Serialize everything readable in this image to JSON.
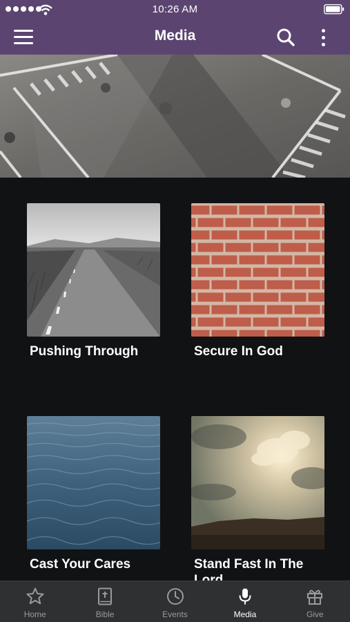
{
  "status_bar": {
    "time": "10:26 AM"
  },
  "app_bar": {
    "title": "Media"
  },
  "media": [
    {
      "title": "Pushing Through"
    },
    {
      "title": "Secure In God"
    },
    {
      "title": "Cast Your Cares"
    },
    {
      "title": "Stand Fast In The Lord"
    }
  ],
  "tabs": [
    {
      "label": "Home",
      "icon": "star-icon",
      "active": false
    },
    {
      "label": "Bible",
      "icon": "bible-icon",
      "active": false
    },
    {
      "label": "Events",
      "icon": "clock-icon",
      "active": false
    },
    {
      "label": "Media",
      "icon": "microphone-icon",
      "active": true
    },
    {
      "label": "Give",
      "icon": "gift-icon",
      "active": false
    }
  ],
  "colors": {
    "header": "#5b4570",
    "background": "#111214",
    "tabbar": "#2f3032"
  }
}
